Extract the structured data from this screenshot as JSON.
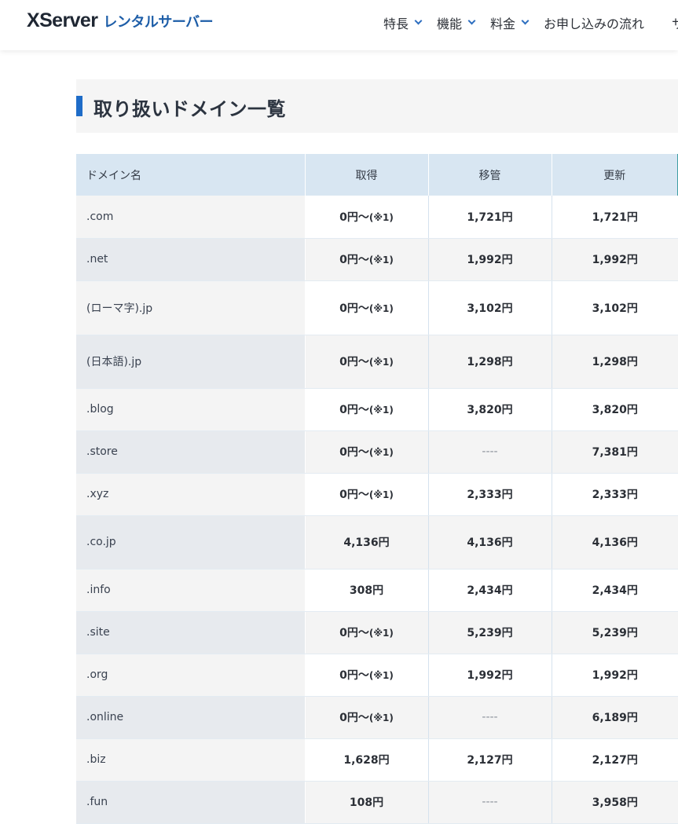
{
  "header": {
    "logo_brand": "XServer",
    "logo_sub": "レンタルサーバー",
    "nav": [
      {
        "label": "特長"
      },
      {
        "label": "機能"
      },
      {
        "label": "料金"
      },
      {
        "label": "お申し込みの流れ"
      }
    ],
    "nav_partial": "サ"
  },
  "section": {
    "title": "取り扱いドメイン一覧"
  },
  "table": {
    "headers": [
      "ドメイン名",
      "取得",
      "移管",
      "更新"
    ],
    "rows": [
      {
        "domain": ".com",
        "acquire": "0円〜",
        "acquire_note": "(※1)",
        "transfer": "1,721円",
        "renew": "1,721円"
      },
      {
        "domain": ".net",
        "acquire": "0円〜",
        "acquire_note": "(※1)",
        "transfer": "1,992円",
        "renew": "1,992円"
      },
      {
        "domain": "(ローマ字).jp",
        "acquire": "0円〜",
        "acquire_note": "(※1)",
        "transfer": "3,102円",
        "renew": "3,102円"
      },
      {
        "domain": "(日本語).jp",
        "acquire": "0円〜",
        "acquire_note": "(※1)",
        "transfer": "1,298円",
        "renew": "1,298円"
      },
      {
        "domain": ".blog",
        "acquire": "0円〜",
        "acquire_note": "(※1)",
        "transfer": "3,820円",
        "renew": "3,820円"
      },
      {
        "domain": ".store",
        "acquire": "0円〜",
        "acquire_note": "(※1)",
        "transfer": "----",
        "renew": "7,381円"
      },
      {
        "domain": ".xyz",
        "acquire": "0円〜",
        "acquire_note": "(※1)",
        "transfer": "2,333円",
        "renew": "2,333円"
      },
      {
        "domain": ".co.jp",
        "acquire": "4,136円",
        "acquire_note": "",
        "transfer": "4,136円",
        "renew": "4,136円"
      },
      {
        "domain": ".info",
        "acquire": "308円",
        "acquire_note": "",
        "transfer": "2,434円",
        "renew": "2,434円"
      },
      {
        "domain": ".site",
        "acquire": "0円〜",
        "acquire_note": "(※1)",
        "transfer": "5,239円",
        "renew": "5,239円"
      },
      {
        "domain": ".org",
        "acquire": "0円〜",
        "acquire_note": "(※1)",
        "transfer": "1,992円",
        "renew": "1,992円"
      },
      {
        "domain": ".online",
        "acquire": "0円〜",
        "acquire_note": "(※1)",
        "transfer": "----",
        "renew": "6,189円"
      },
      {
        "domain": ".biz",
        "acquire": "1,628円",
        "acquire_note": "",
        "transfer": "2,127円",
        "renew": "2,127円"
      },
      {
        "domain": ".fun",
        "acquire": "108円",
        "acquire_note": "",
        "transfer": "----",
        "renew": "3,958円"
      }
    ]
  },
  "colors": {
    "accent": "#1e6cc8",
    "header_bg": "#d8e6f2",
    "logo_sub": "#1e5ea8"
  }
}
